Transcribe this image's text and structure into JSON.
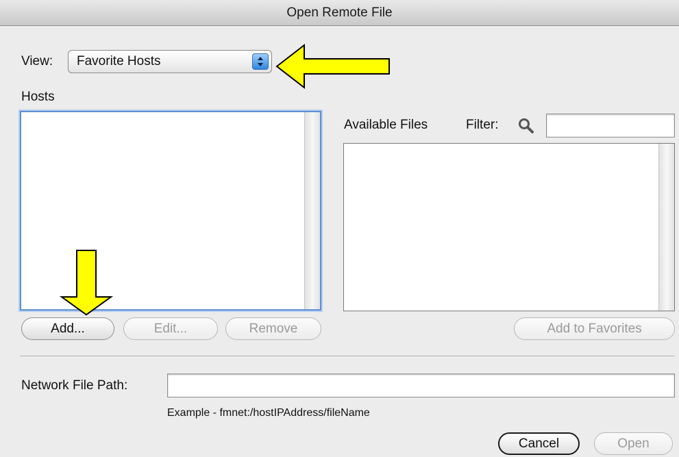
{
  "window": {
    "title": "Open Remote File"
  },
  "view": {
    "label": "View:",
    "selected": "Favorite Hosts"
  },
  "hosts": {
    "label": "Hosts"
  },
  "files": {
    "label": "Available Files",
    "filter_label": "Filter:",
    "filter_value": ""
  },
  "buttons": {
    "add": "Add...",
    "edit": "Edit...",
    "remove": "Remove",
    "add_to_favorites": "Add to Favorites",
    "cancel": "Cancel",
    "open": "Open"
  },
  "network": {
    "label": "Network File Path:",
    "value": "",
    "example": "Example - fmnet:/hostIPAddress/fileName"
  },
  "annotations": {
    "arrow_color": "#ffff00"
  }
}
